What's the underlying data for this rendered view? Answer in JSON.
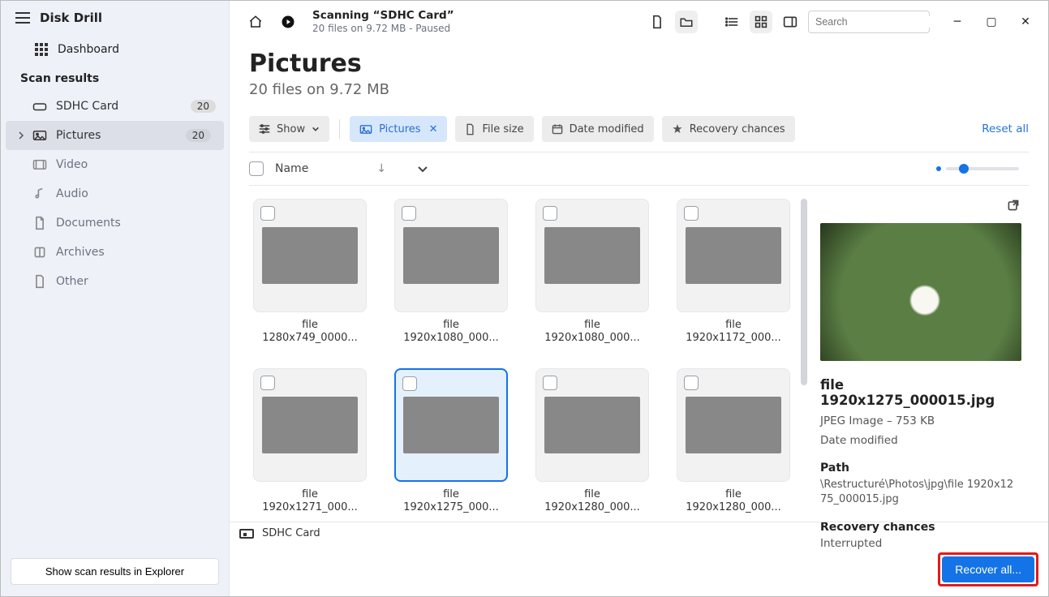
{
  "app_name": "Disk Drill",
  "sidebar": {
    "dashboard": "Dashboard",
    "section": "Scan results",
    "items": [
      {
        "label": "SDHC Card",
        "badge": "20",
        "active": false
      },
      {
        "label": "Pictures",
        "badge": "20",
        "active": true
      },
      {
        "label": "Video"
      },
      {
        "label": "Audio"
      },
      {
        "label": "Documents"
      },
      {
        "label": "Archives"
      },
      {
        "label": "Other"
      }
    ],
    "explorer_btn": "Show scan results in Explorer"
  },
  "titlebar": {
    "scan_title": "Scanning “SDHC Card”",
    "scan_sub": "20 files on 9.72 MB - Paused",
    "search_placeholder": "Search"
  },
  "header": {
    "title": "Pictures",
    "subtitle": "20 files on 9.72 MB"
  },
  "filters": {
    "show": "Show",
    "pictures": "Pictures",
    "file_size": "File size",
    "date_modified": "Date modified",
    "recovery": "Recovery chances",
    "reset": "Reset all"
  },
  "table": {
    "name": "Name"
  },
  "thumbs": [
    {
      "l1": "file",
      "l2": "1280x749_0000..."
    },
    {
      "l1": "file",
      "l2": "1920x1080_000..."
    },
    {
      "l1": "file",
      "l2": "1920x1080_000..."
    },
    {
      "l1": "file",
      "l2": "1920x1172_000..."
    },
    {
      "l1": "file",
      "l2": "1920x1271_000..."
    },
    {
      "l1": "file",
      "l2": "1920x1275_000...",
      "selected": true
    },
    {
      "l1": "file",
      "l2": "1920x1280_000..."
    },
    {
      "l1": "file",
      "l2": "1920x1280_000..."
    }
  ],
  "preview": {
    "title": "file 1920x1275_000015.jpg",
    "meta": "JPEG Image – 753 KB",
    "date_label": "Date modified",
    "path_label": "Path",
    "path": "\\Restructuré\\Photos\\jpg\\file 1920x1275_000015.jpg",
    "rc_label": "Recovery chances",
    "rc_value": "Interrupted"
  },
  "status": {
    "device": "SDHC Card"
  },
  "footer": {
    "recover": "Recover all..."
  }
}
